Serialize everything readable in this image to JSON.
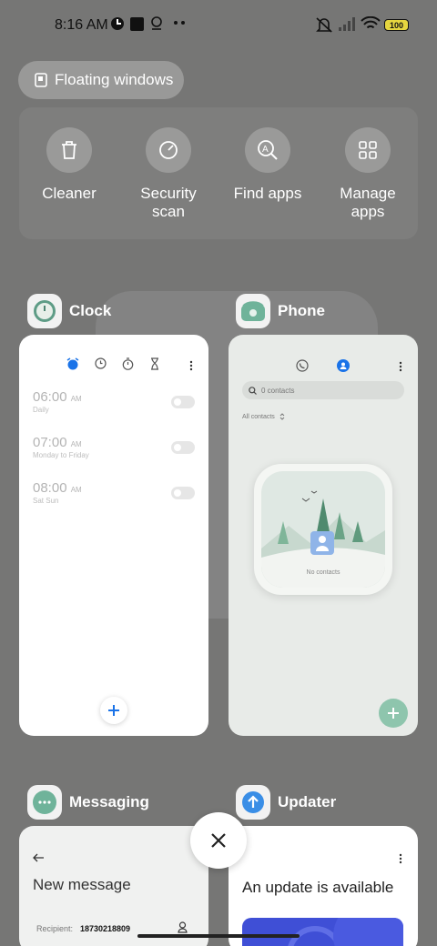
{
  "status_bar": {
    "time": "8:16 AM",
    "battery": "100",
    "icons": [
      "app-icon",
      "square-icon",
      "location-icon",
      "more-dots-icon",
      "mute-icon",
      "signal-icon",
      "wifi-icon",
      "battery-icon"
    ]
  },
  "floating_windows": {
    "label": "Floating windows"
  },
  "tools": [
    {
      "label": "Cleaner",
      "icon": "trash-icon"
    },
    {
      "label": "Security scan",
      "icon": "security-icon"
    },
    {
      "label": "Find apps",
      "icon": "find-apps-icon"
    },
    {
      "label": "Manage apps",
      "icon": "grid-icon"
    }
  ],
  "apps": {
    "clock": {
      "name": "Clock",
      "alarms": [
        {
          "time": "06:00",
          "suffix": "AM",
          "days": "Daily"
        },
        {
          "time": "07:00",
          "suffix": "AM",
          "days": "Monday to Friday"
        },
        {
          "time": "08:00",
          "suffix": "AM",
          "days": "Sat Sun"
        }
      ]
    },
    "phone": {
      "name": "Phone",
      "search_placeholder": "0 contacts",
      "filter": "All contacts",
      "empty": "No contacts"
    },
    "messaging": {
      "name": "Messaging",
      "title": "New message",
      "recipient_label": "Recipient:",
      "recipient_value": "18730218809"
    },
    "updater": {
      "name": "Updater",
      "title": "An update is available"
    }
  },
  "colors": {
    "accent": "#1a73e8",
    "phone_accent": "#7fbfa8",
    "background": "#767675"
  }
}
